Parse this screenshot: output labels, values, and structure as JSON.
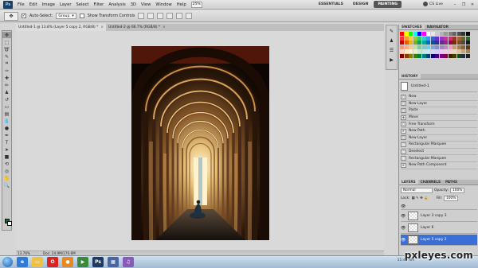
{
  "menubar": {
    "logo": "Ps",
    "items": [
      "File",
      "Edit",
      "Image",
      "Layer",
      "Select",
      "Filter",
      "Analysis",
      "3D",
      "View",
      "Window",
      "Help"
    ],
    "zoom": "25%",
    "workspaces": [
      "ESSENTIALS",
      "DESIGN",
      "PAINTING"
    ],
    "active_workspace": "PAINTING",
    "cs_live": "CS Live"
  },
  "options": {
    "auto_select_label": "Auto-Select:",
    "auto_select_value": "Group",
    "show_transform_label": "Show Transform Controls"
  },
  "doc_tabs": [
    {
      "label": "Untitled-1 @ 13.8% (Layer 5 copy 2, RGB/8) *",
      "active": true
    },
    {
      "label": "Untitled-2 @ 66.7% (RGB/8) *",
      "active": false
    }
  ],
  "status": {
    "zoom": "13.76%",
    "doc": "Doc: 24.9M/170.6M"
  },
  "panels": {
    "swatch_tabs": [
      "SWATCHES",
      "NAVIGATOR"
    ],
    "history_tab": "HISTORY",
    "history_snapshot": "Untitled-1",
    "history_items": [
      "New",
      "New Layer",
      "Paste",
      "Move",
      "Free Transform",
      "New Path",
      "New Layer",
      "Rectangular Marquee",
      "Deselect",
      "Rectangular Marquee",
      "New Path Component"
    ],
    "layer_tabs": [
      "LAYERS",
      "CHANNELS",
      "PATHS"
    ],
    "blend_mode": "Normal",
    "opacity_label": "Opacity:",
    "opacity_value": "100%",
    "lock_label": "Lock:",
    "fill_label": "Fill:",
    "fill_value": "100%",
    "layers": [
      {
        "name": "Layer 3 copy 3",
        "active": false
      },
      {
        "name": "Layer 6",
        "active": false
      },
      {
        "name": "Layer 5 copy 2",
        "active": true
      }
    ]
  },
  "swatch_colors": [
    "#ff0000",
    "#ffff00",
    "#00ff00",
    "#00ffff",
    "#0000ff",
    "#ff00ff",
    "#ffffff",
    "#e6e6e6",
    "#cccccc",
    "#b3b3b3",
    "#999999",
    "#808080",
    "#666666",
    "#4d4d4d",
    "#333333",
    "#000000",
    "#ff3333",
    "#ff9933",
    "#ffcc33",
    "#99cc33",
    "#33cc66",
    "#33cccc",
    "#3399ff",
    "#3366cc",
    "#6633cc",
    "#9933cc",
    "#cc3399",
    "#cc3366",
    "#993333",
    "#996633",
    "#666633",
    "#336633",
    "#cc0000",
    "#e65c00",
    "#e6b800",
    "#7ab317",
    "#00a651",
    "#00a99d",
    "#0072bc",
    "#0054a6",
    "#2e3192",
    "#662d91",
    "#92278f",
    "#9e005d",
    "#7b2e00",
    "#754c24",
    "#534741",
    "#1a1a1a",
    "#f7977a",
    "#f9ad81",
    "#fdc68a",
    "#c4df9b",
    "#82ca9d",
    "#7accc8",
    "#6dcff6",
    "#7da7d9",
    "#8393ca",
    "#a187be",
    "#bc8dbf",
    "#f49ac2",
    "#c69c6d",
    "#a67c52",
    "#8c6239",
    "#603913",
    "#ffd3c2",
    "#ffe6cc",
    "#fff2cc",
    "#e6f2cc",
    "#cce6d6",
    "#cce6e6",
    "#cce6f2",
    "#ccd9f2",
    "#d6ccf2",
    "#e6ccf2",
    "#f2cce6",
    "#f2ccd9",
    "#e6d6c2",
    "#d9c2a6",
    "#c2a680",
    "#a68059",
    "#800000",
    "#804000",
    "#808000",
    "#408000",
    "#008040",
    "#008080",
    "#004080",
    "#000080",
    "#400080",
    "#800080",
    "#800040",
    "#402000",
    "#404000",
    "#204020",
    "#203040",
    "#202020"
  ],
  "taskbar": {
    "clock": "11:45 AM",
    "watermark": "pxleyes.com"
  }
}
